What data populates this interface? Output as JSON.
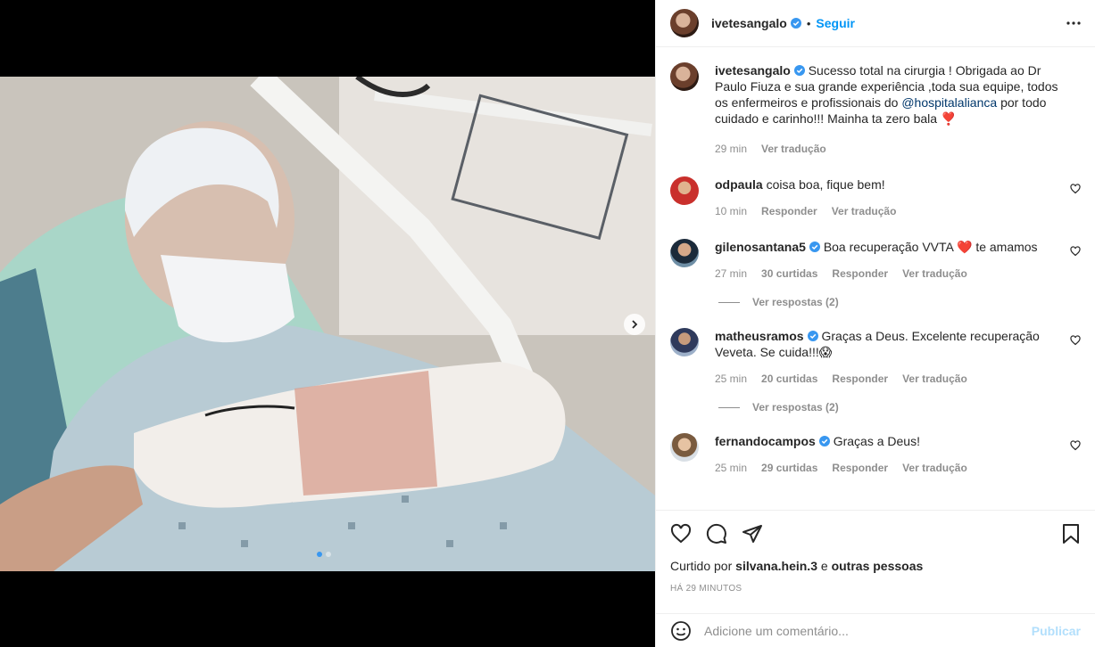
{
  "post": {
    "username": "ivetesangalo",
    "follow_label": "Seguir",
    "separator": "•",
    "caption_text": "Sucesso total na cirurgia ! Obrigada ao Dr Paulo Fiuza e sua grande experiência ,toda sua equipe, todos os enfermeiros e profissionais do",
    "caption_mention": "@hospitalalianca",
    "caption_tail": "por todo cuidado e carinho!!! Mainha ta zero bala",
    "caption_emoji": "❣️",
    "caption_time": "29 min",
    "caption_translate": "Ver tradução"
  },
  "comments": [
    {
      "username": "odpaula",
      "verified": false,
      "text": "coisa boa, fique bem!",
      "time": "10 min",
      "likes": "",
      "reply": "Responder",
      "translate": "Ver tradução"
    },
    {
      "username": "gilenosantana5",
      "verified": true,
      "text_before": "Boa recuperação VVTA",
      "emoji": "❤️",
      "text_after": "te amamos",
      "time": "27 min",
      "likes": "30 curtidas",
      "reply": "Responder",
      "translate": "Ver tradução",
      "view_replies": "Ver respostas (2)"
    },
    {
      "username": "matheusramos",
      "verified": true,
      "text": "Graças a Deus. Excelente recuperação Veveta. Se cuida!!!",
      "emoji": "😱",
      "time": "25 min",
      "likes": "20 curtidas",
      "reply": "Responder",
      "translate": "Ver tradução",
      "view_replies": "Ver respostas (2)"
    },
    {
      "username": "fernandocampos",
      "verified": true,
      "text": "Graças a Deus!",
      "time": "25 min",
      "likes": "29 curtidas",
      "reply": "Responder",
      "translate": "Ver tradução"
    }
  ],
  "likes": {
    "prefix": "Curtido por",
    "user": "silvana.hein.3",
    "conj": "e",
    "others": "outras pessoas"
  },
  "timestamp": "HÁ 29 MINUTOS",
  "add_comment": {
    "placeholder": "Adicione um comentário...",
    "publish_label": "Publicar"
  },
  "carousel": {
    "count": 2,
    "active_index": 0
  },
  "colors": {
    "link": "#0095f6",
    "muted": "#8e8e8e",
    "publish_disabled": "#b2dffc",
    "verified": "#3897f0"
  }
}
